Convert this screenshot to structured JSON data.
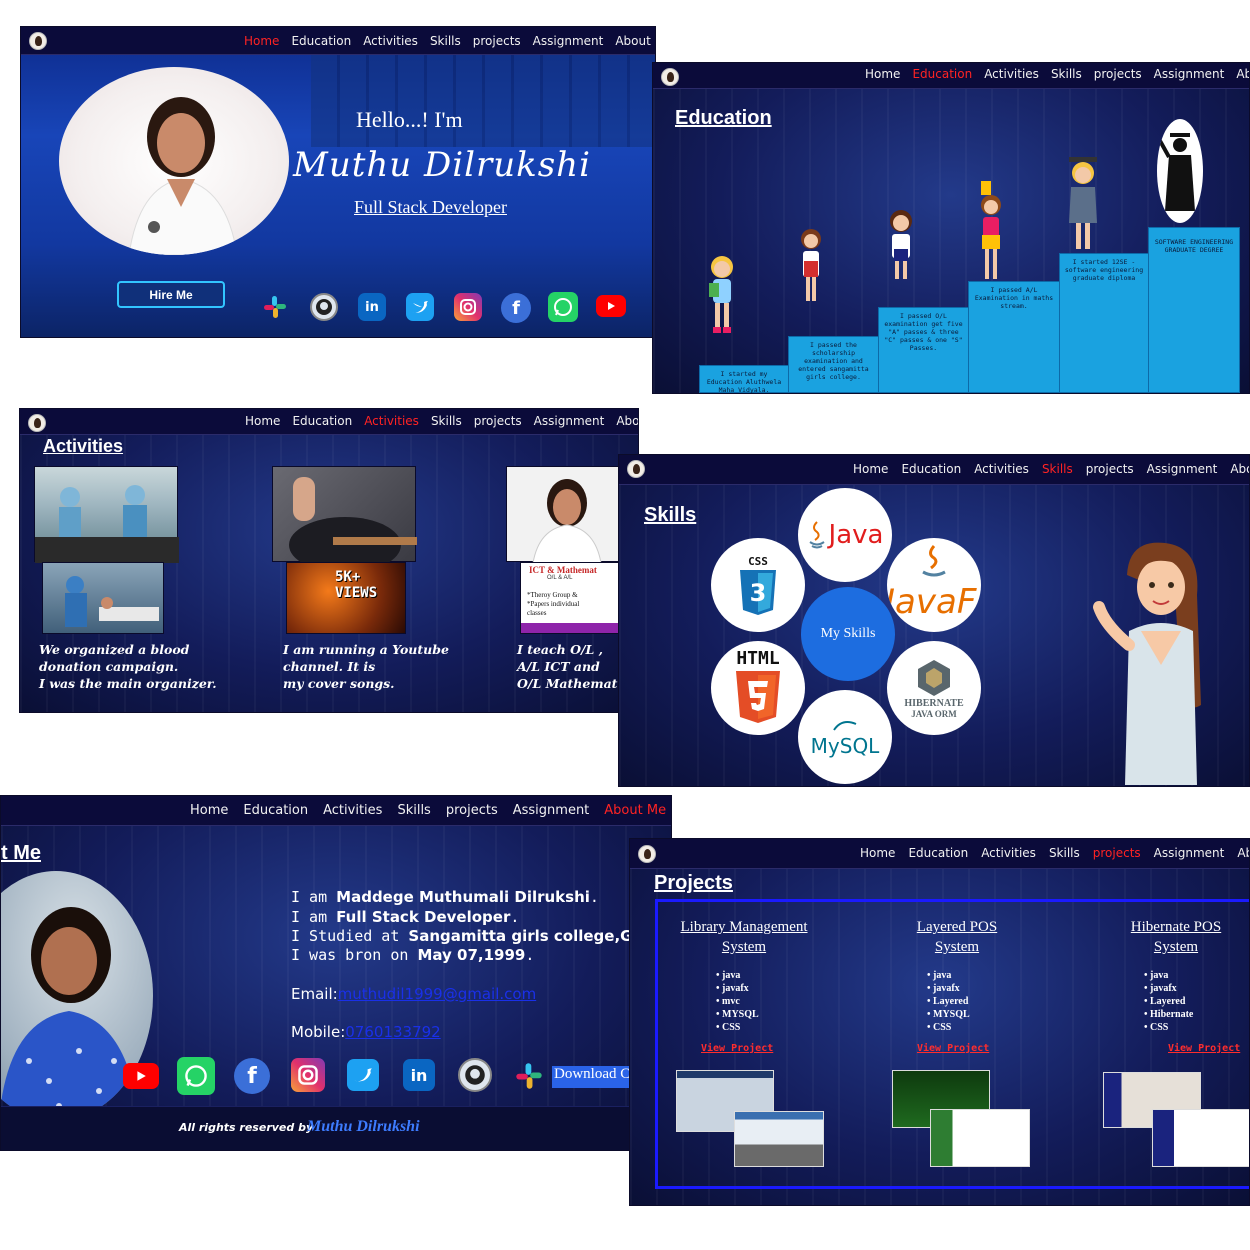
{
  "nav": {
    "items": [
      "Home",
      "Education",
      "Activities",
      "Skills",
      "projects",
      "Assignment",
      "About Me"
    ],
    "item_short_about": "About"
  },
  "home": {
    "greeting": "Hello...!  I'm",
    "name": "Muthu  Dilrukshi",
    "role": "Full Stack Developer",
    "hire_button": "Hire Me",
    "social_icons": [
      "slack-icon",
      "github-icon",
      "linkedin-icon",
      "twitter-icon",
      "instagram-icon",
      "facebook-icon",
      "whatsapp-icon",
      "youtube-icon"
    ]
  },
  "education": {
    "title": "Education",
    "steps": [
      "I started my Education Aluthwela Maha Vidyala.",
      "I passed the scholarship examination and entered sangamitta girls college.",
      "I passed O/L examination get five \"A\" passes & three \"C\" passes & one \"S\" Passes.",
      "I passed A/L Examination in maths stream.",
      "I started 12SE -software engineering graduate diploma",
      "SOFTWARE ENGINEERING GRADUATE DEGREE"
    ]
  },
  "activities": {
    "title": "Activities",
    "captions": [
      [
        "We organized a blood",
        "donation campaign.",
        "I was the main organizer."
      ],
      [
        "I am running a Youtube",
        "channel. It is",
        "my cover songs."
      ],
      [
        "I teach O/L ,",
        "A/L ICT and",
        "O/L Mathemat"
      ]
    ],
    "youtube_badge": "5K+ VIEWS",
    "class_poster_title": "ICT & Mathemat",
    "class_poster_sub": "O/L & A/L",
    "class_poster_lines": [
      "*Theroy  Group &",
      "*Papers  individual",
      "classes"
    ]
  },
  "skills": {
    "title": "Skills",
    "center": "My Skills",
    "items": [
      "Java",
      "JavaFx",
      "HIBERNATE",
      "JAVA ORM",
      "MySQL",
      "HTML",
      "CSS"
    ]
  },
  "about": {
    "title_fragment": "t Me",
    "lines": [
      {
        "pre": "I am ",
        "bold": "Maddege Muthumali Dilrukshi",
        "post": "."
      },
      {
        "pre": "I am ",
        "bold": "Full Stack Developer",
        "post": "."
      },
      {
        "pre": "I Studied at ",
        "bold": "Sangamitta girls college,Galle",
        "post": ""
      },
      {
        "pre": "I was bron on ",
        "bold": "May 07,1999",
        "post": "."
      }
    ],
    "email_label": "Email:",
    "email_value": "muthudil1999@gmail.com",
    "mobile_label": "Mobile:",
    "mobile_value": "0760133792",
    "download": "Download C",
    "footer_prefix": "All rights reserved by",
    "footer_name": "Muthu Dilrukshi"
  },
  "projects": {
    "title": "Projects",
    "items": [
      {
        "title_1": "Library Management",
        "title_2": "System",
        "tech": [
          "java",
          "javafx",
          "mvc",
          "MYSQL",
          "CSS"
        ],
        "button": "View Project"
      },
      {
        "title_1": "Layered POS",
        "title_2": "System",
        "tech": [
          "java",
          "javafx",
          "Layered",
          "MYSQL",
          "CSS"
        ],
        "button": "View Project"
      },
      {
        "title_1": "Hibernate POS",
        "title_2": "System",
        "tech": [
          "java",
          "javafx",
          "Layered",
          "Hibernate",
          "CSS"
        ],
        "button": "View Project"
      }
    ]
  },
  "colors": {
    "active_nav": "#ff2323",
    "bg_dark": "#0b0b3a",
    "step_blue": "#1aa2e0",
    "frame_blue": "#1a1aff"
  }
}
